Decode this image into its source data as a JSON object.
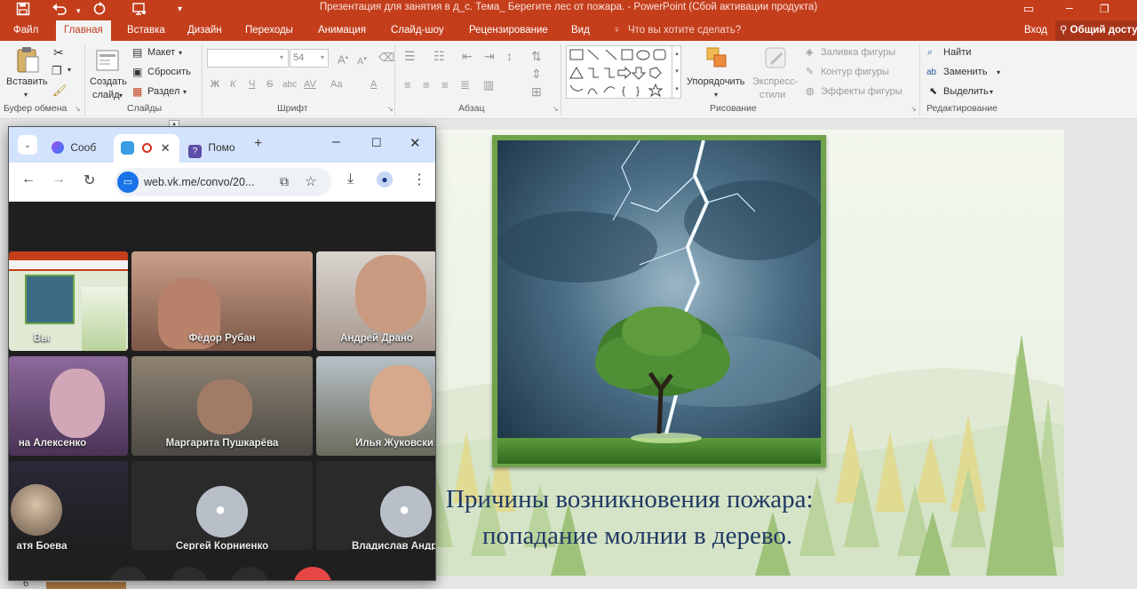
{
  "app": {
    "doc_title": "Презентация для занятия в д_с. Тема_ Берегите лес от пожара. - PowerPoint (Сбой активации продукта)"
  },
  "menu": {
    "file": "Файл",
    "tabs": [
      "Главная",
      "Вставка",
      "Дизайн",
      "Переходы",
      "Анимация",
      "Слайд-шоу",
      "Рецензирование",
      "Вид"
    ],
    "tell_me": "Что вы хотите сделать?",
    "signin": "Вход",
    "share": "Общий досту"
  },
  "ribbon": {
    "clipboard": {
      "paste": "Вставить",
      "group": "Буфер обмена"
    },
    "slides": {
      "new_slide_line1": "Создать",
      "new_slide_line2": "слайд",
      "layout": "Макет",
      "reset": "Сбросить",
      "section": "Раздел",
      "group": "Слайды"
    },
    "font": {
      "size": "54",
      "bold": "Ж",
      "italic": "К",
      "underline": "Ч",
      "strike": "S",
      "shadow": "abc",
      "spacing": "AV",
      "case": "Aa",
      "color": "A",
      "group": "Шрифт"
    },
    "paragraph": {
      "group": "Абзац"
    },
    "drawing": {
      "arrange": "Упорядочить",
      "quick_styles_line1": "Экспресс-",
      "quick_styles_line2": "стили",
      "fill": "Заливка фигуры",
      "outline": "Контур фигуры",
      "effects": "Эффекты фигуры",
      "group": "Рисование"
    },
    "editing": {
      "find": "Найти",
      "replace": "Заменить",
      "select": "Выделить",
      "group": "Редактирование"
    }
  },
  "slide": {
    "line1": "Причины возникновения пожара:",
    "line2": "попадание молнии в дерево."
  },
  "browser": {
    "tabs": [
      "Сооб",
      "Помо"
    ],
    "url": "web.vk.me/convo/20...",
    "participants": [
      {
        "name": "Вы"
      },
      {
        "name": "Фёдор Рубан"
      },
      {
        "name": "Андрей Драно"
      },
      {
        "name": "на Алексенко"
      },
      {
        "name": "Маргарита Пушкарёва"
      },
      {
        "name": "Илья Жуковски"
      },
      {
        "name": "атя Боева"
      },
      {
        "name": "Сергей Корниенко"
      },
      {
        "name": "Владислав Андрие"
      }
    ]
  },
  "slide_panel": {
    "slide_number": "6"
  },
  "colors": {
    "accent": "#c43e1c",
    "ribbon_bg": "#f3f3f3",
    "browser_tab_bg": "#d3e3fd",
    "slide_text": "#1f3864",
    "photo_frame": "#6ea34a"
  }
}
